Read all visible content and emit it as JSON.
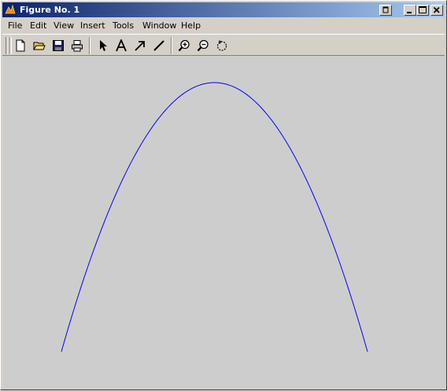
{
  "window": {
    "title": "Figure No. 1",
    "controls": [
      "extra-button",
      "minimize",
      "maximize",
      "close"
    ]
  },
  "menubar": {
    "items": [
      "File",
      "Edit",
      "View",
      "Insert",
      "Tools",
      "Window",
      "Help"
    ]
  },
  "toolbar": {
    "buttons": [
      "new-figure",
      "open-file",
      "save",
      "print",
      "edit-plot-arrow",
      "insert-text",
      "insert-arrow",
      "insert-line",
      "zoom-in",
      "zoom-out",
      "rotate-3d"
    ]
  },
  "colors": {
    "title_bar_start": "#0a246a",
    "title_bar_end": "#a6caf0",
    "figure_background": "#cdcdcd",
    "curve": "#0000ff"
  },
  "chart_data": {
    "type": "line",
    "title": "",
    "xlabel": "",
    "ylabel": "",
    "axes_visible": false,
    "grid": false,
    "series": [
      {
        "x": [
          -1,
          -0.75,
          -0.5,
          -0.25,
          0,
          0.25,
          0.5,
          0.75,
          1
        ],
        "y": [
          0,
          0.4375,
          0.75,
          0.9375,
          1,
          0.9375,
          0.75,
          0.4375,
          0
        ]
      }
    ],
    "xlim": [
      -1,
      1
    ],
    "ylim": [
      0,
      1
    ]
  }
}
